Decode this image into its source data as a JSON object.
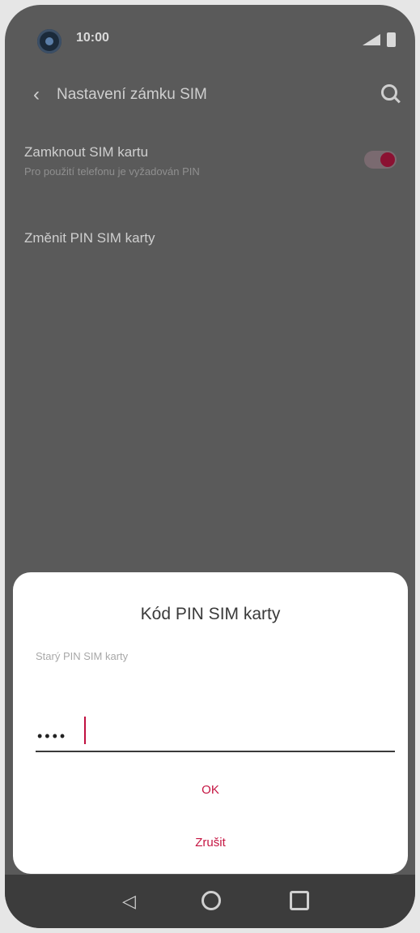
{
  "status_bar": {
    "time": "10:00"
  },
  "header": {
    "title": "Nastavení zámku SIM"
  },
  "settings": {
    "lock_sim": {
      "title": "Zamknout SIM kartu",
      "subtitle": "Pro použití telefonu je vyžadován PIN",
      "enabled": true
    },
    "change_pin": {
      "title": "Změnit PIN SIM karty"
    }
  },
  "dialog": {
    "title": "Kód PIN SIM karty",
    "label": "Starý PIN SIM karty",
    "pin_value": "••••",
    "ok_label": "OK",
    "cancel_label": "Zrušit"
  },
  "colors": {
    "accent": "#c51542",
    "scrim": "#5a5a5a"
  },
  "icons": {
    "back": "arrow-left",
    "search": "magnifier",
    "nav_back": "triangle-left",
    "nav_home": "circle",
    "nav_recent": "square"
  }
}
